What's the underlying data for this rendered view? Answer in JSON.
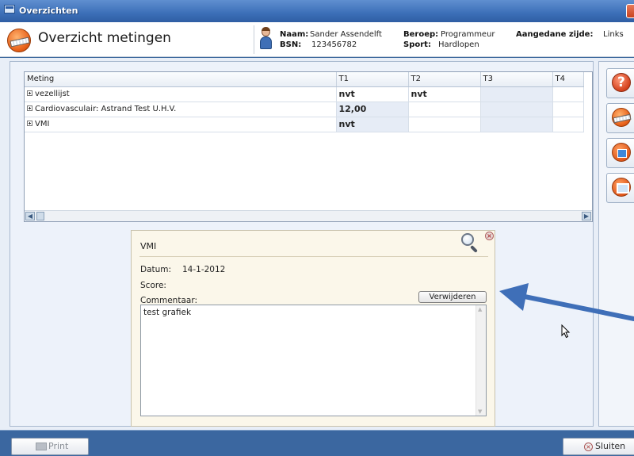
{
  "window": {
    "title": "Overzichten"
  },
  "header": {
    "title": "Overzicht metingen",
    "naam_label": "Naam:",
    "naam_value": "Sander Assendelft",
    "bsn_label": "BSN:",
    "bsn_value": "123456782",
    "beroep_label": "Beroep:",
    "beroep_value": "Programmeur",
    "sport_label": "Sport:",
    "sport_value": "Hardlopen",
    "zijde_label": "Aangedane zijde:",
    "zijde_value": "Links"
  },
  "grid": {
    "columns": [
      "Meting",
      "T1",
      "T2",
      "T3",
      "T4"
    ],
    "rows": [
      {
        "name": "vezellijst",
        "t1": "nvt",
        "t2": "nvt",
        "t3": "",
        "t4": ""
      },
      {
        "name": "Cardiovasculair: Astrand Test U.H.V.",
        "t1": "12,00",
        "t2": "",
        "t3": "",
        "t4": ""
      },
      {
        "name": "VMI",
        "t1": "nvt",
        "t2": "",
        "t3": "",
        "t4": ""
      }
    ]
  },
  "detail": {
    "title": "VMI",
    "datum_label": "Datum:",
    "datum_value": "14-1-2012",
    "score_label": "Score:",
    "commentaar_label": "Commentaar:",
    "delete_label": "Verwijderen",
    "comment_text": "test grafiek"
  },
  "footer": {
    "print_label": "Print",
    "close_label": "Sluiten"
  },
  "colors": {
    "titlebar": "#3c6fb8",
    "footer": "#3b67a0",
    "arrow": "#3f6fb8",
    "detail_bg": "#fbf7ea"
  },
  "icons": [
    "window-icon",
    "measurement-icon",
    "person-icon",
    "help-icon",
    "home-icon",
    "monitor-icon",
    "magnifier-icon",
    "close-icon",
    "printer-icon"
  ]
}
